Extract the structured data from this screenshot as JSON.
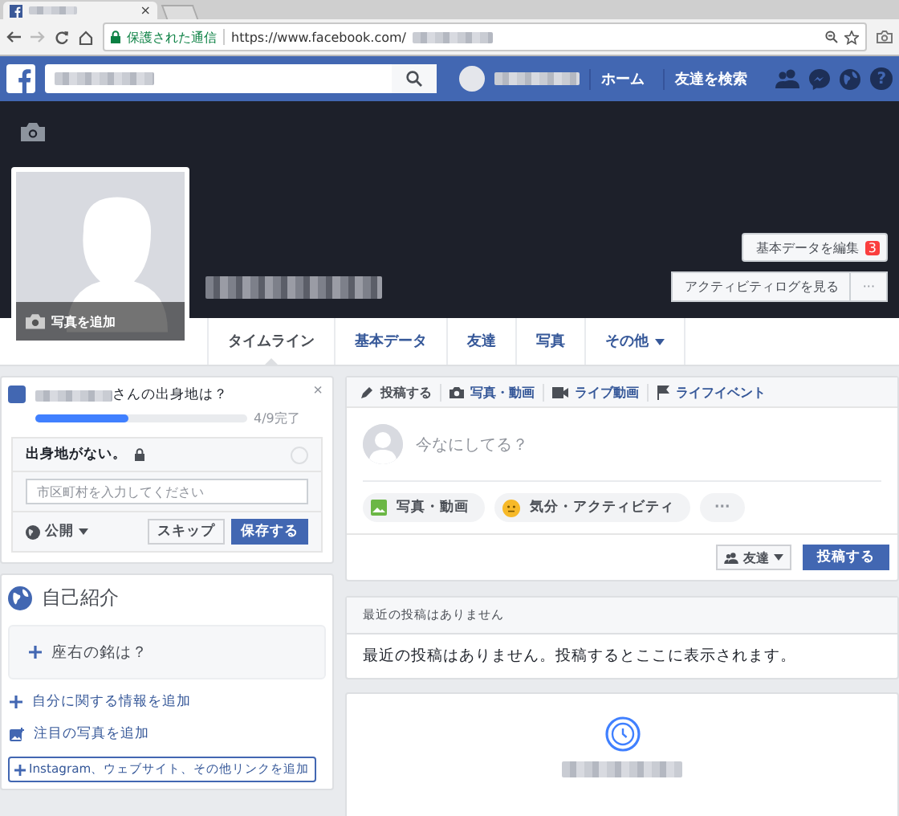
{
  "browser": {
    "close": "×",
    "security": "保護された通信",
    "url": "https://www.facebook.com/"
  },
  "nav": {
    "links": [
      "ホーム",
      "友達を検索"
    ],
    "help": "?"
  },
  "cover": {
    "add_photo": "写真を追加",
    "edit_button": "基本データを編集",
    "edit_badge": "3",
    "log_button": "アクティビティログを見る",
    "more": "···"
  },
  "tabs": [
    {
      "label": "タイムライン",
      "selected": true,
      "dropdown": false
    },
    {
      "label": "基本データ",
      "selected": false,
      "dropdown": false
    },
    {
      "label": "友達",
      "selected": false,
      "dropdown": false
    },
    {
      "label": "写真",
      "selected": false,
      "dropdown": false
    },
    {
      "label": "その他",
      "selected": false,
      "dropdown": true
    }
  ],
  "question_card": {
    "title": "さんの出身地は？",
    "close": "×",
    "progress": {
      "level": 0.44,
      "reading": "4/9完了"
    },
    "question": "出身地がない。",
    "checked": false,
    "placeholder": "市区町村を入力してください",
    "privacy": "公開",
    "skip": "スキップ",
    "save": "保存する"
  },
  "composer": {
    "tabs": [
      {
        "label": "投稿する",
        "kind": "pencil",
        "selected": true
      },
      {
        "label": "写真・動画",
        "kind": "camera",
        "selected": false
      },
      {
        "label": "ライブ動画",
        "kind": "video",
        "selected": false
      },
      {
        "label": "ライフイベント",
        "kind": "flag",
        "selected": false
      }
    ],
    "placeholder": "今なにしてる？",
    "actions": [
      {
        "label": "写真・動画",
        "kind": "photo"
      },
      {
        "label": "気分・アクティビティ",
        "kind": "feeling"
      },
      {
        "label": "···",
        "kind": "more"
      }
    ],
    "audience": "友達",
    "submit": "投稿する"
  },
  "intro": {
    "title": "自己紹介",
    "motto": "座右の銘は？",
    "links": [
      {
        "label": "自分に関する情報を追加",
        "kind": "plus"
      },
      {
        "label": "注目の写真を追加",
        "kind": "photo"
      }
    ],
    "add_links": "Instagram、ウェブサイト、その他リンクを追加"
  },
  "recent": {
    "header": "最近の投稿はありません",
    "body": "最近の投稿はありません。投稿するとここに表示されます。"
  }
}
